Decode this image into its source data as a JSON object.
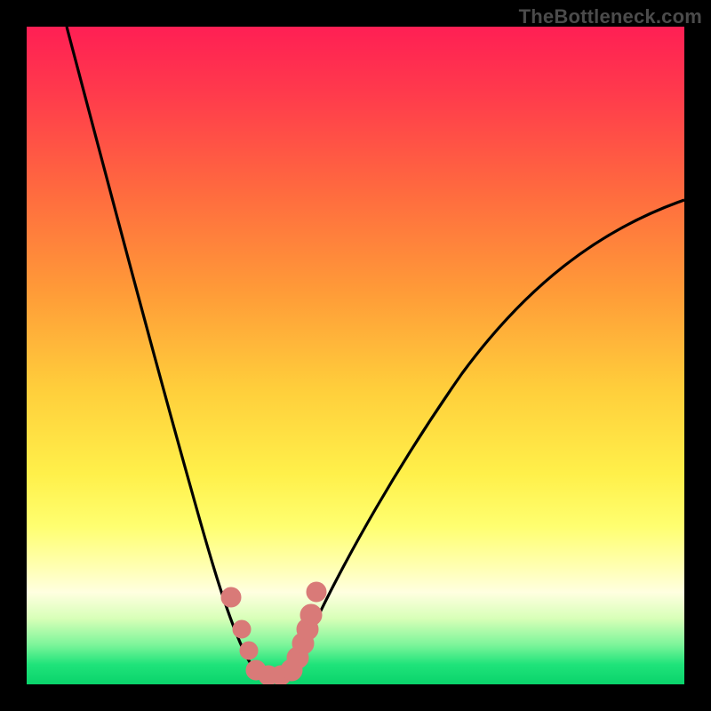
{
  "watermark": "TheBottleneck.com",
  "colors": {
    "frame": "#000000",
    "curve": "#000000",
    "marker": "#d97a78",
    "gradient_top": "#ff1f54",
    "gradient_bottom": "#0ad36b"
  },
  "chart_data": {
    "type": "line",
    "title": "",
    "xlabel": "",
    "ylabel": "",
    "xlim": [
      0,
      100
    ],
    "ylim": [
      0,
      100
    ],
    "series": [
      {
        "name": "bottleneck-curve",
        "x": [
          3,
          5,
          10,
          15,
          20,
          25,
          27,
          30,
          32,
          34,
          36,
          38,
          40,
          45,
          50,
          55,
          60,
          65,
          70,
          75,
          80,
          85,
          90,
          95,
          100
        ],
        "y": [
          100,
          90,
          70,
          52,
          35,
          18,
          12,
          5,
          2,
          0,
          0,
          1,
          3,
          10,
          18,
          25,
          32,
          38,
          44,
          49,
          54,
          58,
          62,
          65,
          68
        ]
      }
    ],
    "markers": {
      "name": "highlighted-range",
      "x": [
        29.5,
        31,
        33,
        35,
        37,
        38.5,
        39
      ],
      "y": [
        11,
        6,
        1,
        0,
        1,
        5,
        11
      ]
    }
  }
}
